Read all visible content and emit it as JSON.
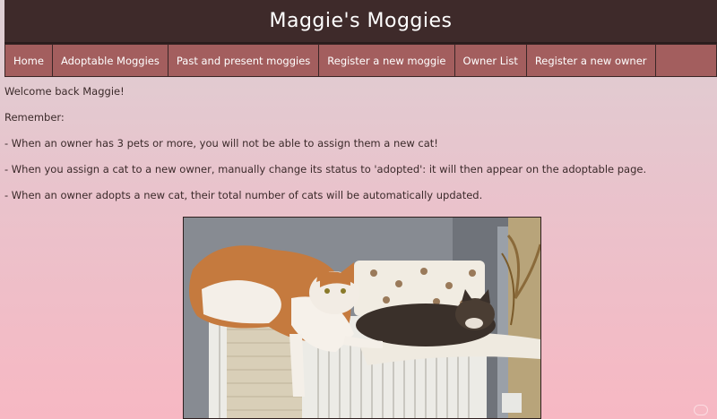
{
  "header": {
    "title": "Maggie's Moggies"
  },
  "nav": {
    "items": [
      {
        "label": "Home"
      },
      {
        "label": "Adoptable Moggies"
      },
      {
        "label": "Past and present moggies"
      },
      {
        "label": "Register a new moggie"
      },
      {
        "label": "Owner List"
      },
      {
        "label": "Register a new owner"
      }
    ]
  },
  "main": {
    "welcome": "Welcome back Maggie!",
    "remember": "Remember:",
    "rules": [
      "- When an owner has 3 pets or more, you will not be able to assign them a new cat!",
      "- When you assign a cat to a new owner, manually change its status to 'adopted': it will then appear on the adoptable page.",
      "- When an owner adopts a new cat, their total number of cats will be automatically updated."
    ]
  },
  "photo": {
    "icon": "cats-on-radiator-photo"
  },
  "colors": {
    "header_bg": "#3e2a2a",
    "nav_bg": "#a35e5e",
    "page_top": "#ddd0d4",
    "page_bottom": "#f7b8c3"
  }
}
